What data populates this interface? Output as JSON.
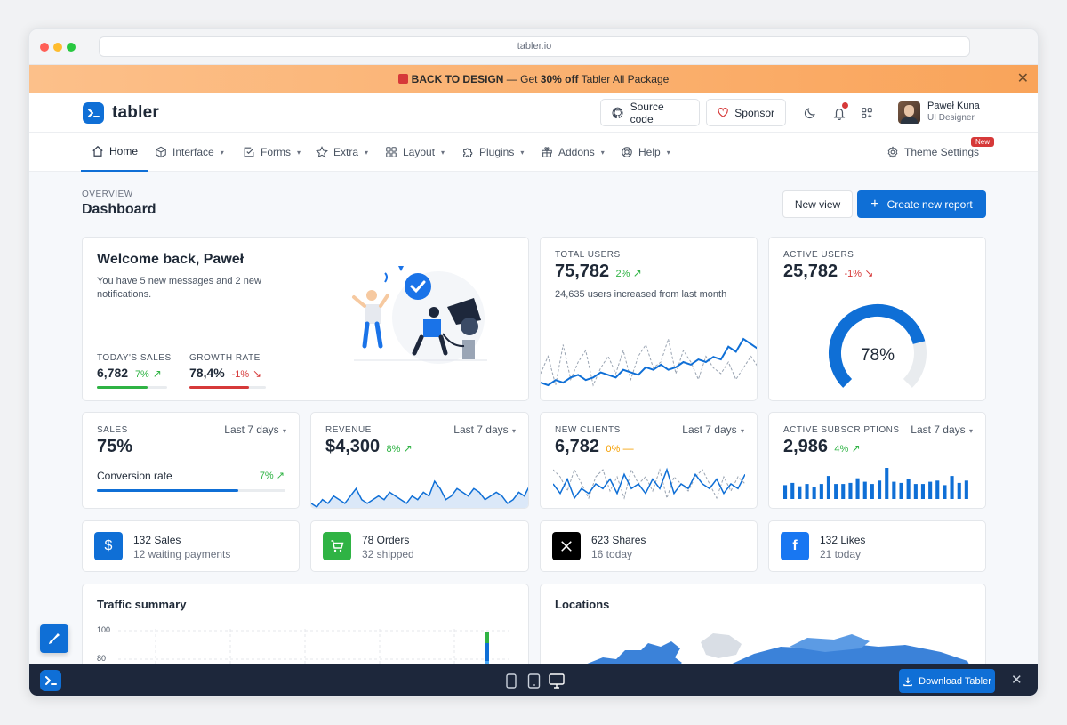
{
  "browser": {
    "url": "tabler.io"
  },
  "promo": {
    "prefix": "BACK TO DESIGN",
    "mid": " — Get ",
    "discount": "30% off",
    "suffix": " Tabler All Package"
  },
  "header": {
    "logo_text": "tabler",
    "source_code_label": "Source code",
    "sponsor_label": "Sponsor",
    "user_name": "Paweł Kuna",
    "user_role": "UI Designer"
  },
  "nav": {
    "items": [
      {
        "label": "Home"
      },
      {
        "label": "Interface"
      },
      {
        "label": "Forms"
      },
      {
        "label": "Extra"
      },
      {
        "label": "Layout"
      },
      {
        "label": "Plugins"
      },
      {
        "label": "Addons"
      },
      {
        "label": "Help"
      }
    ],
    "theme_settings": "Theme Settings",
    "theme_badge": "New"
  },
  "page": {
    "pretitle": "OVERVIEW",
    "title": "Dashboard",
    "new_view_label": "New view",
    "create_report_label": "Create new report"
  },
  "welcome": {
    "title": "Welcome back, Paweł",
    "text": "You have 5 new messages and 2 new notifications.",
    "today_sales_label": "TODAY'S SALES",
    "today_sales_value": "6,782",
    "today_sales_delta": "7%",
    "today_sales_progress": 0.72,
    "growth_label": "GROWTH RATE",
    "growth_value": "78,4%",
    "growth_delta": "-1%",
    "growth_progress": 0.78
  },
  "total_users": {
    "label": "TOTAL USERS",
    "value": "75,782",
    "delta": "2%",
    "subtext": "24,635 users increased from last month",
    "series1": [
      10,
      9,
      11,
      10,
      12,
      13,
      11,
      12,
      14,
      13,
      12,
      15,
      14,
      13,
      16,
      15,
      17,
      15,
      16,
      18,
      17,
      19,
      18,
      20,
      19,
      24,
      22,
      27,
      25,
      23
    ],
    "series2": [
      14,
      17,
      12,
      19,
      13,
      16,
      18,
      12,
      15,
      17,
      14,
      18,
      13,
      17,
      19,
      15,
      16,
      20,
      14,
      18,
      16,
      13,
      17,
      15,
      14,
      16,
      13,
      15,
      17,
      15
    ]
  },
  "active_users": {
    "label": "ACTIVE USERS",
    "value": "25,782",
    "delta": "-1%",
    "gauge_percent": 78,
    "gauge_label": "78%"
  },
  "sales": {
    "label": "SALES",
    "value": "75%",
    "period": "Last 7 days",
    "conv_label": "Conversion rate",
    "conv_delta": "7%",
    "conv_progress": 0.75
  },
  "revenue": {
    "label": "REVENUE",
    "value": "$4,300",
    "delta": "8%",
    "period": "Last 7 days",
    "series": [
      8,
      7,
      9,
      8,
      10,
      9,
      8,
      10,
      12,
      9,
      8,
      9,
      10,
      9,
      11,
      10,
      9,
      8,
      10,
      9,
      11,
      10,
      14,
      12,
      9,
      10,
      12,
      11,
      10,
      12,
      11,
      9,
      10,
      11,
      10,
      8,
      9,
      11,
      10,
      13
    ]
  },
  "new_clients": {
    "label": "NEW CLIENTS",
    "value": "6,782",
    "delta": "0%",
    "period": "Last 7 days",
    "series1": [
      14,
      12,
      15,
      11,
      13,
      12,
      14,
      13,
      15,
      12,
      16,
      13,
      14,
      12,
      15,
      13,
      17,
      12,
      14,
      13,
      16,
      14,
      13,
      15,
      12,
      14,
      13,
      16
    ],
    "series2": [
      16,
      15,
      13,
      16,
      14,
      12,
      15,
      16,
      13,
      15,
      12,
      16,
      14,
      15,
      13,
      16,
      12,
      15,
      14,
      13,
      15,
      16,
      14,
      12,
      15,
      13,
      15,
      14
    ]
  },
  "subscriptions": {
    "label": "ACTIVE SUBSCRIPTIONS",
    "value": "2,986",
    "delta": "4%",
    "period": "Last 7 days",
    "bars": [
      12,
      14,
      11,
      13,
      10,
      13,
      20,
      13,
      13,
      14,
      18,
      15,
      13,
      16,
      27,
      15,
      14,
      17,
      13,
      13,
      15,
      16,
      12,
      20,
      14,
      16
    ]
  },
  "stats": [
    {
      "line1": "132 Sales",
      "line2": "12 waiting payments"
    },
    {
      "line1": "78 Orders",
      "line2": "32 shipped"
    },
    {
      "line1": "623 Shares",
      "line2": "16 today"
    },
    {
      "line1": "132 Likes",
      "line2": "21 today"
    }
  ],
  "traffic": {
    "title": "Traffic summary",
    "yticks": [
      "100",
      "80"
    ]
  },
  "locations": {
    "title": "Locations"
  },
  "footer": {
    "download_label": "Download Tabler"
  },
  "colors": {
    "primary": "#0f6fd6",
    "success": "#2fb344",
    "danger": "#d63939",
    "warning": "#f59f00",
    "dark": "#1d273b"
  }
}
